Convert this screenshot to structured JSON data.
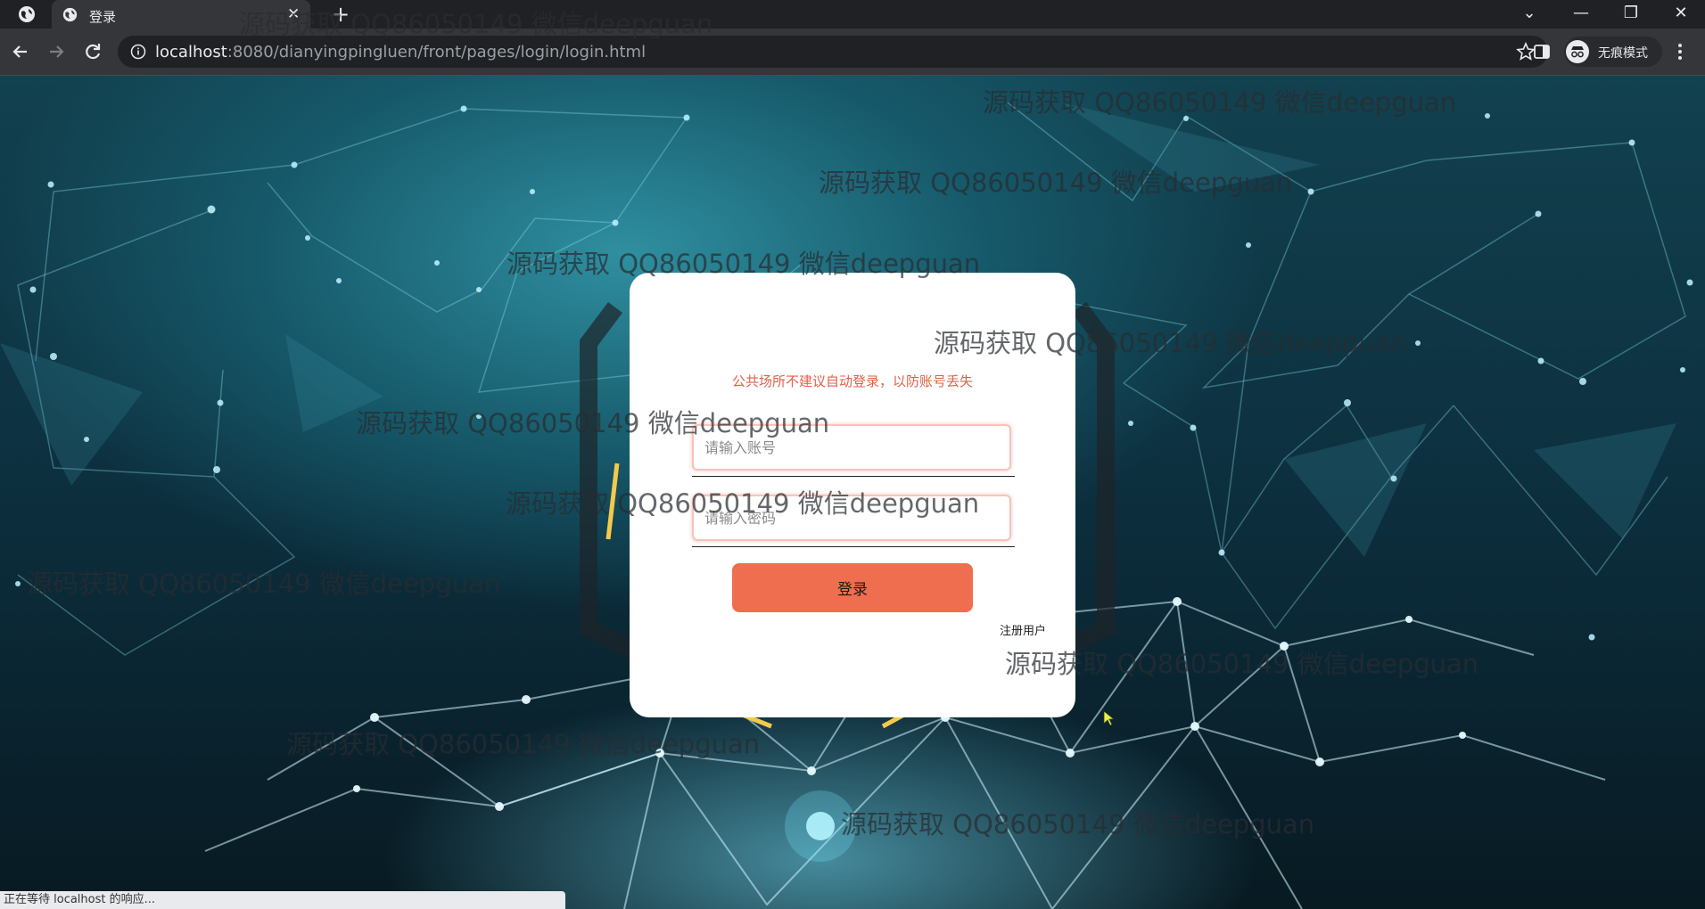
{
  "browser": {
    "tab_title": "登录",
    "tab_close": "✕",
    "new_tab": "+",
    "url_host": "localhost",
    "url_rest": ":8080/dianyingpingluen/front/pages/login/login.html",
    "incognito_label": "无痕模式",
    "window_controls": [
      "⌄",
      "—",
      "❐",
      "✕"
    ],
    "status_text": "正在等待 localhost 的响应..."
  },
  "login": {
    "notice": "公共场所不建议自动登录，以防账号丢失",
    "username_placeholder": "请输入账号",
    "password_placeholder": "请输入密码",
    "login_button": "登录",
    "register_link": "注册用户"
  },
  "watermark": {
    "text": "源码获取 QQ86050149 微信deepguan"
  },
  "colors": {
    "accent": "#ef6e4f",
    "notice": "#e0604a"
  }
}
